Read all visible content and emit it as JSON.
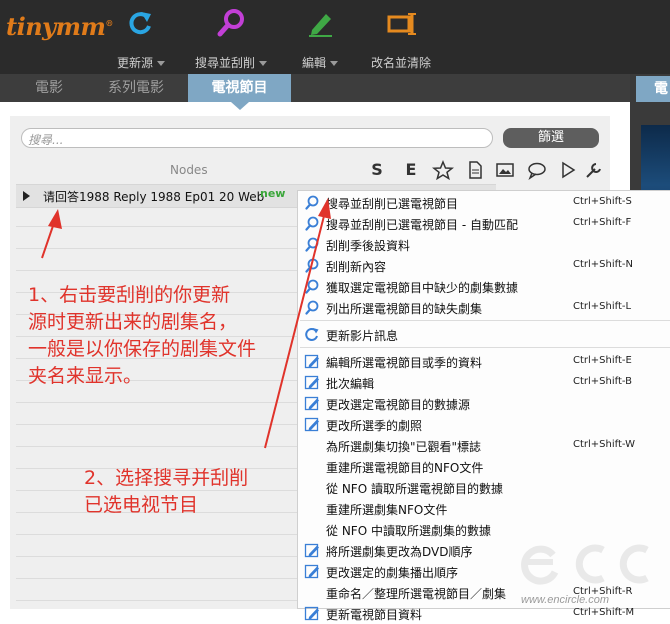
{
  "app": {
    "logo": "tinymm",
    "logo_mark": "®"
  },
  "toolbar": [
    {
      "label": "更新源",
      "icon": "refresh-icon",
      "dropdown": true
    },
    {
      "label": "搜尋並刮削",
      "icon": "search-icon",
      "dropdown": true
    },
    {
      "label": "編輯",
      "icon": "pencil-icon",
      "dropdown": true
    },
    {
      "label": "改名並清除",
      "icon": "rename-icon",
      "dropdown": false
    }
  ],
  "tabs": [
    {
      "label": "電影",
      "active": false
    },
    {
      "label": "系列電影",
      "active": false
    },
    {
      "label": "電視節目",
      "active": true
    }
  ],
  "right_tab": "電視",
  "search": {
    "placeholder": "搜尋..."
  },
  "filter_button": "篩選",
  "table": {
    "header": "Nodes",
    "column_icons": [
      "S",
      "E",
      "star-icon",
      "document-icon",
      "image-icon",
      "chat-icon",
      "play-icon",
      "wrench-icon"
    ],
    "rows": [
      {
        "name": "请回答1988 Reply 1988 Ep01 20 Web",
        "badge": "new"
      }
    ]
  },
  "context_menu": {
    "groups": [
      [
        {
          "label": "搜尋並刮削已選電視節目",
          "shortcut": "Ctrl+Shift-S",
          "icon": "search-icon"
        },
        {
          "label": "搜尋並刮削已選電視節目 - 自動匹配",
          "shortcut": "Ctrl+Shift-F",
          "icon": "search-icon"
        },
        {
          "label": "刮削季後設資料",
          "shortcut": "",
          "icon": "search-icon"
        },
        {
          "label": "刮削新內容",
          "shortcut": "Ctrl+Shift-N",
          "icon": "search-icon"
        },
        {
          "label": "獲取選定電視節目中缺少的劇集數據",
          "shortcut": "",
          "icon": "search-icon"
        },
        {
          "label": "列出所選電視節目的缺失劇集",
          "shortcut": "Ctrl+Shift-L",
          "icon": "search-icon"
        }
      ],
      [
        {
          "label": "更新影片訊息",
          "shortcut": "",
          "icon": "refresh-icon"
        }
      ],
      [
        {
          "label": "編輯所選電視節目或季的資料",
          "shortcut": "Ctrl+Shift-E",
          "icon": "edit-icon"
        },
        {
          "label": "批次編輯",
          "shortcut": "Ctrl+Shift-B",
          "icon": "edit-icon"
        },
        {
          "label": "更改選定電視節目的數據源",
          "shortcut": "",
          "icon": "edit-icon"
        },
        {
          "label": "更改所選季的劇照",
          "shortcut": "",
          "icon": "edit-icon"
        },
        {
          "label": "為所選劇集切換\"已觀看\"標誌",
          "shortcut": "Ctrl+Shift-W",
          "icon": ""
        },
        {
          "label": "重建所選電視節目的NFO文件",
          "shortcut": "",
          "icon": ""
        },
        {
          "label": "從 NFO 讀取所選電視節目的數據",
          "shortcut": "",
          "icon": ""
        },
        {
          "label": "重建所選劇集NFO文件",
          "shortcut": "",
          "icon": ""
        },
        {
          "label": "從 NFO 中讀取所選劇集的數據",
          "shortcut": "",
          "icon": ""
        },
        {
          "label": "將所選劇集更改為DVD順序",
          "shortcut": "",
          "icon": "edit-icon"
        },
        {
          "label": "更改選定的劇集播出順序",
          "shortcut": "",
          "icon": "edit-icon"
        },
        {
          "label": "重命名／整理所選電視節目／劇集",
          "shortcut": "Ctrl+Shift-R",
          "icon": ""
        },
        {
          "label": "更新電視節目資料",
          "shortcut": "Ctrl+Shift-M",
          "icon": "edit-icon"
        }
      ]
    ]
  },
  "annotations": {
    "note1": [
      "1、右击要刮削的你更新",
      "源时更新出来的剧集名，",
      "一般是以你保存的剧集文件",
      "夹名来显示。"
    ],
    "note2": [
      "2、选择搜寻并刮削",
      "已选电视节目"
    ]
  },
  "watermark": {
    "logo": "ecc",
    "url": "www.encircle.com"
  },
  "colors": {
    "accent": "#7fa7c4",
    "annotation": "#e0332b",
    "logo": "#e07b1a",
    "new_badge": "#3aa63a"
  }
}
